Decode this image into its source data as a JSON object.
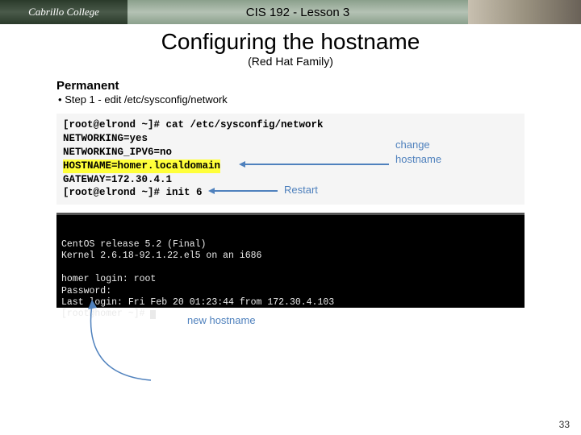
{
  "header": {
    "logo_text": "Cabrillo College",
    "course_label": "CIS 192 - Lesson 3"
  },
  "title": "Configuring the hostname",
  "subtitle": "(Red Hat Family)",
  "section_heading": "Permanent",
  "step_bullet": "•",
  "step_text_prefix": "Step 1 ",
  "step_dash": "-",
  "step_text_rest": " edit /etc/sysconfig/network",
  "codeblock": {
    "prompt1": "[root@elrond ~]# ",
    "cmd1": "cat /etc/sysconfig/network",
    "l2": "NETWORKING=yes",
    "l3": "NETWORKING_IPV6=no",
    "l4": "HOSTNAME=homer.localdomain",
    "l5": "GATEWAY=172.30.4.1",
    "prompt2": "[root@elrond ~]# ",
    "cmd2": "init 6"
  },
  "annotations": {
    "change_line1": "change",
    "change_line2": "hostname",
    "restart": "Restart"
  },
  "terminal": {
    "l1": "CentOS release 5.2 (Final)",
    "l2": "Kernel 2.6.18-92.1.22.el5 on an i686",
    "l3": "",
    "l4": "homer login: root",
    "l5": "Password:",
    "l6": "Last login: Fri Feb 20 01:23:44 from 172.30.4.103",
    "l7_prompt": "[root@homer ~]# "
  },
  "new_hostname_label": "new hostname",
  "page_number": "33"
}
